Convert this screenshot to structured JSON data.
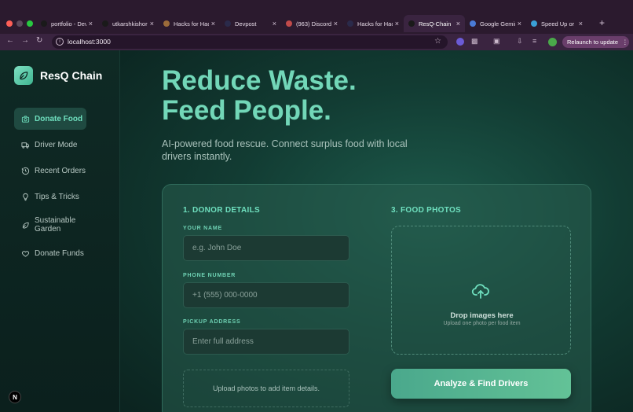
{
  "browser": {
    "tabs": [
      {
        "title": "portfolio - Dev",
        "favicon_color": "#1a1a1a"
      },
      {
        "title": "utkarshkishore",
        "favicon_color": "#1a1a1a"
      },
      {
        "title": "Hacks for Hack",
        "favicon_color": "#9b6b3a"
      },
      {
        "title": "Devpost",
        "favicon_color": "#2a2a4a"
      },
      {
        "title": "(963) Discord",
        "favicon_color": "#c14a4a"
      },
      {
        "title": "Hacks for Hack",
        "favicon_color": "#2a2a4a"
      },
      {
        "title": "ResQ-Chain",
        "favicon_color": "#1a1a1a",
        "active": true
      },
      {
        "title": "Google Gemini",
        "favicon_color": "#4a7bd6"
      },
      {
        "title": "Speed Up or",
        "favicon_color": "#3aa0d6"
      }
    ],
    "url": "localhost:3000",
    "relaunch_label": "Relaunch to update"
  },
  "sidebar": {
    "brand": "ResQ Chain",
    "items": [
      {
        "label": "Donate Food",
        "icon": "camera-icon",
        "active": true
      },
      {
        "label": "Driver Mode",
        "icon": "truck-icon"
      },
      {
        "label": "Recent Orders",
        "icon": "history-icon"
      },
      {
        "label": "Tips & Tricks",
        "icon": "lightbulb-icon"
      },
      {
        "label": "Sustainable Garden",
        "icon": "leaf-icon"
      },
      {
        "label": "Donate Funds",
        "icon": "heart-icon"
      }
    ],
    "badge": "N"
  },
  "hero": {
    "title_line1": "Reduce Waste.",
    "title_line2": "Feed People.",
    "subtitle": "AI-powered food rescue. Connect surplus food with local drivers instantly."
  },
  "form": {
    "donor_title": "1. DONOR DETAILS",
    "name_label": "YOUR NAME",
    "name_placeholder": "e.g. John Doe",
    "phone_label": "PHONE NUMBER",
    "phone_placeholder": "+1 (555) 000-0000",
    "address_label": "PICKUP ADDRESS",
    "address_placeholder": "Enter full address",
    "upload_hint": "Upload photos to add item details.",
    "photos_title": "3. FOOD PHOTOS",
    "drop_title": "Drop images here",
    "drop_sub": "Upload one photo per food item",
    "cta": "Analyze & Find Drivers"
  },
  "colors": {
    "accent": "#72d7b8",
    "sidebar_active_bg": "#1f4a41",
    "cta_start": "#4aa88c",
    "cta_end": "#63c297"
  }
}
